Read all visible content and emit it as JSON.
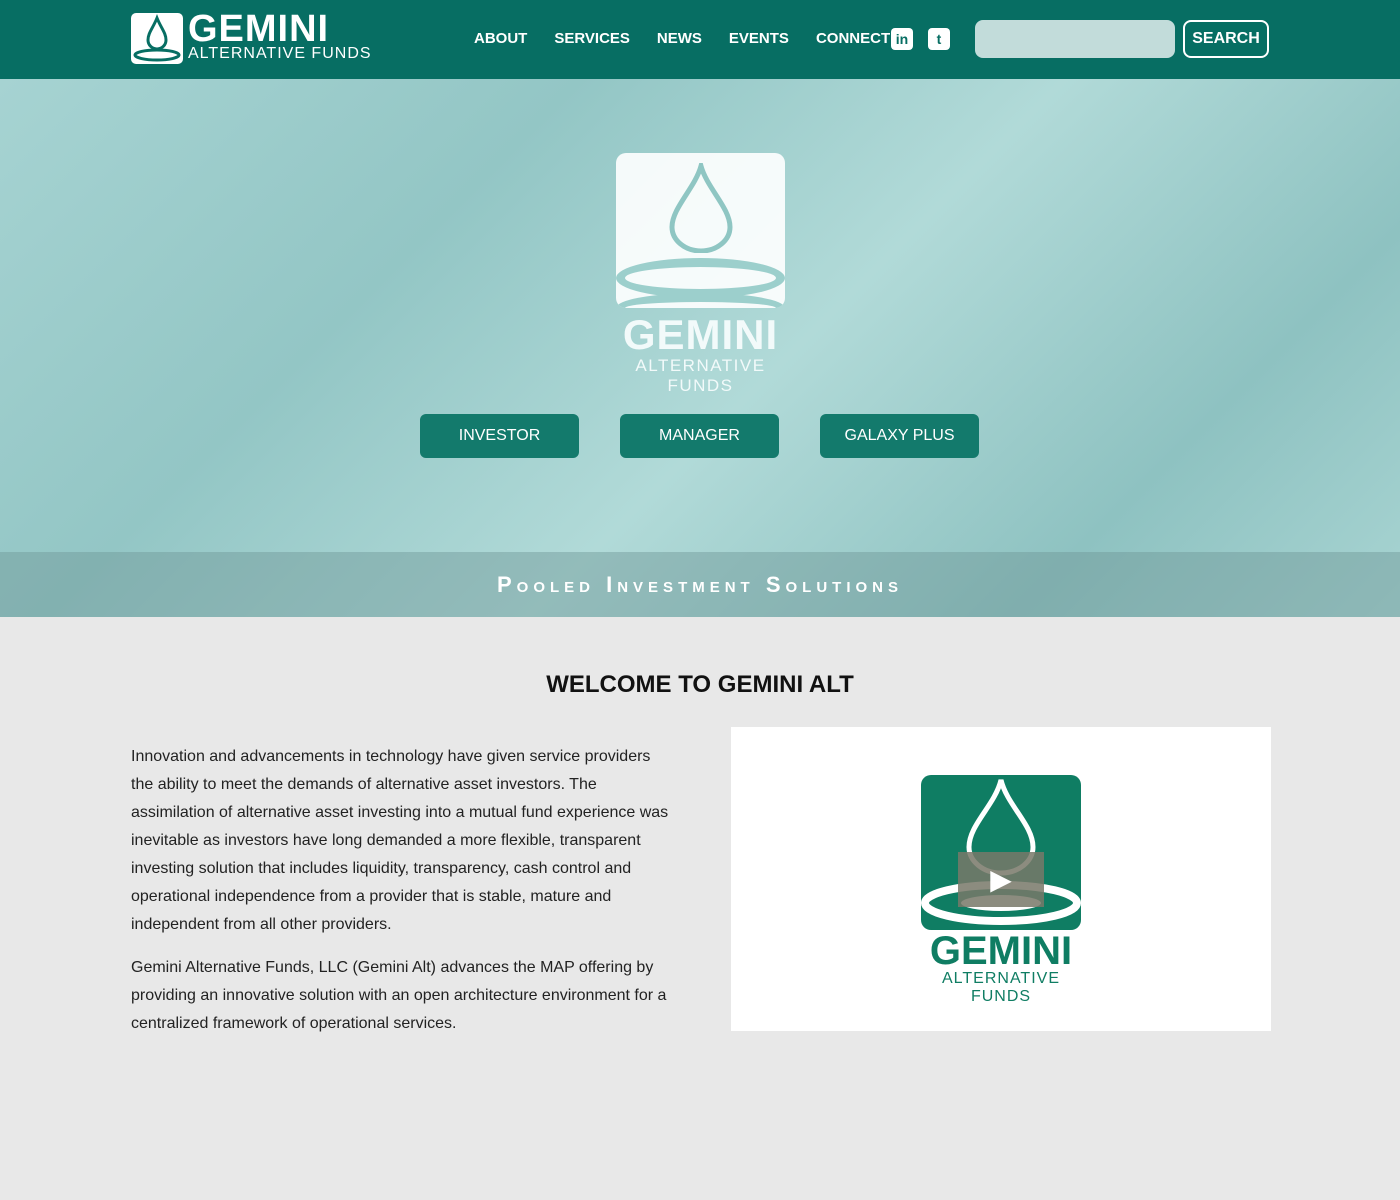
{
  "header": {
    "logo_big": "GEMINI",
    "logo_small": "ALTERNATIVE FUNDS",
    "nav": [
      "ABOUT",
      "SERVICES",
      "NEWS",
      "EVENTS",
      "CONNECT"
    ],
    "social": [
      {
        "icon": "linkedin-icon",
        "glyph": "in"
      },
      {
        "icon": "twitter-icon",
        "glyph": "t"
      }
    ],
    "search_placeholder": "",
    "search_label": "SEARCH"
  },
  "hero": {
    "logo_big": "GEMINI",
    "logo_small": "ALTERNATIVE FUNDS",
    "buttons": [
      "INVESTOR",
      "MANAGER",
      "GALAXY PLUS"
    ],
    "tagline": "Pooled Investment Solutions"
  },
  "main": {
    "title": "WELCOME TO GEMINI ALT",
    "paragraphs": [
      "Innovation and advancements in technology have given service providers the ability to meet the demands of alternative asset investors. The assimilation of alternative asset investing into a mutual fund experience was inevitable as investors have long demanded a more flexible, transparent investing solution that includes liquidity, transparency, cash control and operational independence from a provider that is stable, mature and independent from all other providers.",
      "Gemini Alternative Funds, LLC (Gemini Alt) advances the MAP offering by providing an innovative solution with an open architecture environment for a centralized framework of operational services."
    ],
    "video": {
      "logo_big": "GEMINI",
      "logo_small": "ALTERNATIVE FUNDS",
      "play_icon": "play-icon"
    }
  },
  "colors": {
    "header": "#076e63",
    "button": "#137a6c",
    "brand_green": "#0f7d63",
    "background": "#e8e8e8"
  }
}
